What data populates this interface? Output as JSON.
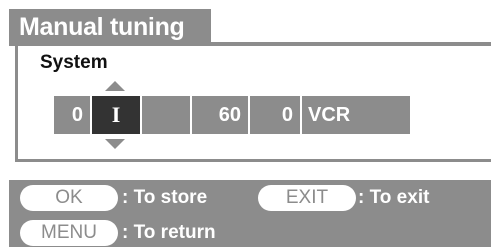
{
  "title": "Manual tuning",
  "section": {
    "label": "System"
  },
  "fields": {
    "f1": "0",
    "f2": "I",
    "f3": "",
    "f4": "60",
    "f5": "0",
    "f6": "VCR"
  },
  "selected_field": "f2",
  "help": {
    "ok_key": "OK",
    "ok_text": ": To store",
    "exit_key": "EXIT",
    "exit_text": ": To exit",
    "menu_key": "MENU",
    "menu_text": ": To return"
  },
  "icons": {
    "up": "up-arrow-icon",
    "down": "down-arrow-icon"
  },
  "colors": {
    "bar_gray": "#8c8c8c",
    "selected_dark": "#333333",
    "text_white": "#ffffff"
  }
}
